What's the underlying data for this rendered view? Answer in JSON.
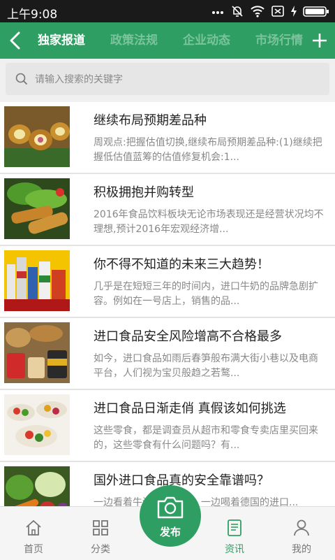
{
  "status_bar": {
    "time": "上午9:08"
  },
  "nav": {
    "tabs": [
      {
        "label": "独家报道",
        "active": true
      },
      {
        "label": "政策法规",
        "active": false
      },
      {
        "label": "企业动态",
        "active": false
      },
      {
        "label": "市场行情",
        "active": false
      }
    ]
  },
  "search": {
    "placeholder": "请输入搜索的关键字"
  },
  "articles": [
    {
      "title": "继续布局预期差品种",
      "desc": "周观点:把握估值切换,继续布局预期差品种:(1)继续把握低估值蓝筹的估值修复机会:1...",
      "thumb": "fried-rolls-photo"
    },
    {
      "title": "积极拥抱并购转型",
      "desc": "2016年食品饮料板块无论市场表现还是经营状况均不理想,预计2016年宏观经济增...",
      "thumb": "cutlet-salad-photo"
    },
    {
      "title": "你不得不知道的未来三大趋势！",
      "desc": "几乎是在短短三年的时间内，进口牛奶的品牌急剧扩容。例如在一号店上，销售的品...",
      "thumb": "imported-goods-shelf-photo"
    },
    {
      "title": "进口食品安全风险增高不合格最多",
      "desc": "如今，进口食品如雨后春笋般布满大街小巷以及电商平台，人们视为宝贝般趋之若鹜...",
      "thumb": "bread-and-cans-photo"
    },
    {
      "title": "进口食品日渐走俏 真假该如何挑选",
      "desc": "这些零食，都是调查员从超市和零食专卖店里买回来的，这些零食有什么问题吗？有...",
      "thumb": "buffet-platter-photo"
    },
    {
      "title": "国外进口食品真的安全靠谱吗？",
      "desc": "一边看着牛津腔的英剧，一边喝着德国的进口...",
      "thumb": "vegetables-photo"
    }
  ],
  "tabbar": {
    "items": [
      {
        "label": "首页",
        "icon": "home-icon"
      },
      {
        "label": "分类",
        "icon": "grid-icon"
      },
      {
        "label": "资讯",
        "icon": "news-icon",
        "active": true
      },
      {
        "label": "我的",
        "icon": "person-icon"
      }
    ],
    "publish_label": "发布"
  },
  "colors": {
    "accent": "#2f9e63",
    "tab_inactive": "#7ac49d"
  }
}
